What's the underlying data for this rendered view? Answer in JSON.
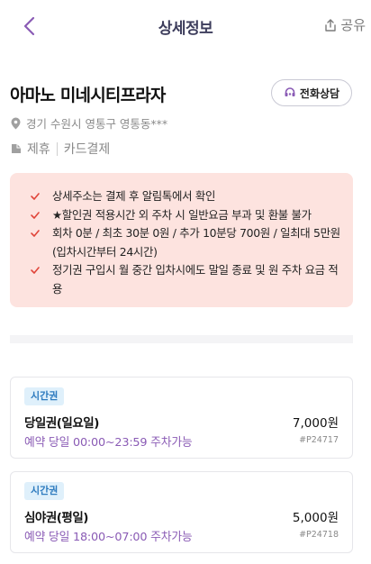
{
  "header": {
    "title": "상세정보",
    "back_icon": "chevron-left-icon",
    "share_icon": "share-icon",
    "share_label": "공유"
  },
  "place": {
    "name": "아마노 미네시티프라자",
    "call_label": "전화상담",
    "call_icon": "headset-icon",
    "address": "경기 수원시 영통구 영통동***",
    "tags": [
      "제휴",
      "카드결제"
    ]
  },
  "notices": [
    "상세주소는 결제 후 알림톡에서 확인",
    "★할인권 적용시간 외 주차 시 일반요금 부과 및 환불 불가",
    "회차 0분 / 최초 30분 0원 / 추가 10분당 700원 / 일최대 5만원 (입차시간부터 24시간)",
    "정기권 구입시 월 중간 입차시에도 말일 종료 및 원 주차 요금 적용"
  ],
  "tickets": [
    {
      "badge": "시간권",
      "name": "당일권(일요일)",
      "price": "7,000원",
      "time": "예약 당일 00:00~23:59 주차가능",
      "code": "#P24717"
    },
    {
      "badge": "시간권",
      "name": "심야권(평일)",
      "price": "5,000원",
      "time": "예약 당일 18:00~07:00 주차가능",
      "code": "#P24718"
    }
  ],
  "colors": {
    "accent_purple": "#8a5bb5",
    "notice_bg": "#fde3df",
    "notice_check": "#e0453a",
    "badge_bg": "#dff0fb",
    "badge_text": "#2e7bbf"
  }
}
